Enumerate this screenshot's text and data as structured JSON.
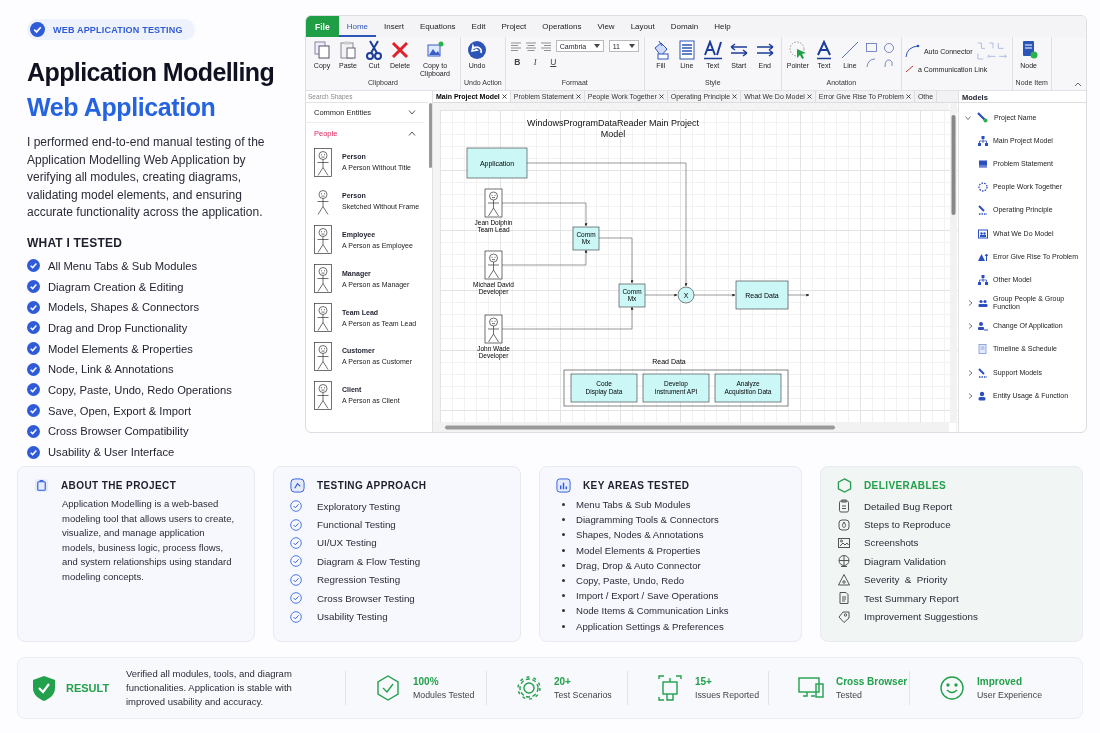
{
  "badge": "WEB APPLICATION TESTING",
  "title": "Application Modelling",
  "subtitle": "Web Application",
  "intro": "I performed end-to-end manual testing of the Application Modelling Web Application by verifying all modules, creating diagrams, validating model elements, and ensuring accurate functionality across the application.",
  "tested": {
    "heading": "WHAT I TESTED",
    "items": [
      "All Menu Tabs & Sub Modules",
      "Diagram Creation & Editing",
      "Models, Shapes & Connectors",
      "Drag and Drop Functionality",
      "Model Elements & Properties",
      "Node, Link & Annotations",
      "Copy, Paste, Undo, Redo Operations",
      "Save, Open, Export & Import",
      "Cross Browser Compatibility",
      "Usability & User Interface"
    ]
  },
  "app": {
    "file_menu": "File",
    "menu": [
      {
        "label": "Home",
        "selected": true
      },
      {
        "label": "Insert",
        "selected": false
      },
      {
        "label": "Equations",
        "selected": false
      },
      {
        "label": "Edit",
        "selected": false
      },
      {
        "label": "Project",
        "selected": false
      },
      {
        "label": "Operations",
        "selected": false
      },
      {
        "label": "View",
        "selected": false
      },
      {
        "label": "Layout",
        "selected": false
      },
      {
        "label": "Domain",
        "selected": false
      },
      {
        "label": "Help",
        "selected": false
      }
    ],
    "ribbon": [
      {
        "kind": "tools",
        "title": "Clipboard",
        "tools": [
          "Copy",
          "Paste",
          "Cut",
          "Delete",
          "Copy to Clipboard"
        ]
      },
      {
        "kind": "tools",
        "title": "Undo Action",
        "tools": [
          "Undo"
        ]
      },
      {
        "kind": "format",
        "title": "Formaat",
        "font": "Cambria",
        "size": "11",
        "styles": [
          "B",
          "I",
          "U"
        ]
      },
      {
        "kind": "tools",
        "title": "Style",
        "tools": [
          "Fill",
          "Line",
          "Text",
          "Start",
          "End"
        ]
      },
      {
        "kind": "annotation",
        "title": "Anotation",
        "tools": [
          "Pointer",
          "Text",
          "Line"
        ]
      },
      {
        "kind": "connector",
        "tools": [
          "Auto Connector",
          "a Communication Link"
        ]
      },
      {
        "kind": "tools",
        "title": "Node Item",
        "tools": [
          "Node"
        ]
      }
    ],
    "palette": {
      "search_placeholder": "Search Shapes",
      "sections": [
        {
          "title": "Common Entities",
          "expanded": false
        },
        {
          "title": "People",
          "expanded": true,
          "items": [
            {
              "name": "Person",
              "desc": "A Person Without Title",
              "kind": "framed"
            },
            {
              "name": "Person",
              "desc": "Sketched Without Frame",
              "kind": "sketch"
            },
            {
              "name": "Employee",
              "desc": "A Person as Employee",
              "kind": "framed"
            },
            {
              "name": "Manager",
              "desc": "A Person as Manager",
              "kind": "framed"
            },
            {
              "name": "Team Lead",
              "desc": "A Person as Team Lead",
              "kind": "framed"
            },
            {
              "name": "Customer",
              "desc": "A Person as Customer",
              "kind": "framed"
            },
            {
              "name": "Client",
              "desc": "A Person as Client",
              "kind": "framed"
            }
          ]
        }
      ]
    },
    "tabs": [
      {
        "label": "Main Project Model",
        "selected": true,
        "closable": true
      },
      {
        "label": "Problem Statement",
        "selected": false,
        "closable": true
      },
      {
        "label": "People Work Together",
        "selected": false,
        "closable": true
      },
      {
        "label": "Operating Principle",
        "selected": false,
        "closable": true
      },
      {
        "label": "What We Do Model",
        "selected": false,
        "closable": true
      },
      {
        "label": "Error Give Rise To Problem",
        "selected": false,
        "closable": true
      },
      {
        "label": "Othe",
        "selected": false,
        "closable": false
      }
    ],
    "diagram": {
      "title": "WindowsProgramDataReader Main Project Model",
      "application": "Application",
      "actors": [
        {
          "name": "Jean Dolphin",
          "role": "Team Lead"
        },
        {
          "name": "Michael David",
          "role": "Developer"
        },
        {
          "name": "John Wade",
          "role": "Developer"
        }
      ],
      "mixers": [
        [
          "Comm",
          "Mx"
        ],
        [
          "Comm",
          "Mx"
        ]
      ],
      "junction": "X",
      "output": "Read Data",
      "group_label": "Read Data",
      "group": [
        [
          "Code",
          "Display Data"
        ],
        [
          "Develop",
          "Instrument API"
        ],
        [
          "Analyze",
          "Acquisition Data"
        ]
      ]
    },
    "models": {
      "title": "Models",
      "root": {
        "label": "Project Name",
        "expanded": true,
        "children": [
          {
            "label": "Main Project Model",
            "kind": "model"
          },
          {
            "label": "Problem Statement",
            "kind": "model"
          },
          {
            "label": "People Work Together",
            "kind": "model"
          },
          {
            "label": "Operating Principle",
            "kind": "model"
          },
          {
            "label": "What We Do Model",
            "kind": "model"
          },
          {
            "label": "Error Give Rise To Problem",
            "kind": "model"
          },
          {
            "label": "Other Model",
            "kind": "model"
          },
          {
            "label": "Group People & Group Function",
            "kind": "group"
          },
          {
            "label": "Change Of Application",
            "kind": "group"
          },
          {
            "label": "Timeline & Schedule",
            "kind": "model"
          },
          {
            "label": "Support Models",
            "kind": "group"
          },
          {
            "label": "Entity Usage & Function",
            "kind": "group"
          }
        ]
      }
    }
  },
  "cards": [
    {
      "kind": "about",
      "title": "ABOUT THE PROJECT",
      "text": "Application Modelling is a web-based modeling tool that allows users to create, visualize, and manage application models, business logic, process flows, and system relationships using standard modeling concepts."
    },
    {
      "kind": "checks",
      "title": "TESTING APPROACH",
      "items": [
        "Exploratory Testing",
        "Functional Testing",
        "UI/UX Testing",
        "Diagram & Flow Testing",
        "Regression Testing",
        "Cross Browser Testing",
        "Usability Testing"
      ]
    },
    {
      "kind": "bullets",
      "title": "KEY AREAS TESTED",
      "items": [
        "Menu Tabs & Sub Modules",
        "Diagramming Tools & Connectors",
        "Shapes, Nodes & Annotations",
        "Model Elements & Properties",
        "Drag, Drop & Auto Connector",
        "Copy, Paste, Undo, Redo",
        "Import / Export / Save Operations",
        "Node Items & Communication Links",
        "Application Settings & Preferences"
      ]
    },
    {
      "kind": "deliverables",
      "title": "DELIVERABLES",
      "items": [
        "Detailed Bug Report",
        "Steps to Reproduce",
        "Screenshots",
        "Diagram Validation",
        "Severity  &  Priority",
        "Test Summary Report",
        "Improvement Suggestions"
      ]
    }
  ],
  "result": {
    "label": "RESULT",
    "text": "Verified all modules, tools, and diagram functionalities. Application is stable with improved usability and accuracy.",
    "stats": [
      {
        "value": "100%",
        "label": "Modules Tested"
      },
      {
        "value": "20+",
        "label": "Test Scenarios"
      },
      {
        "value": "15+",
        "label": "Issues Reported"
      },
      {
        "value": "Cross Browser",
        "label": "Tested"
      },
      {
        "value": "Improved",
        "label": "User Experience"
      }
    ]
  }
}
